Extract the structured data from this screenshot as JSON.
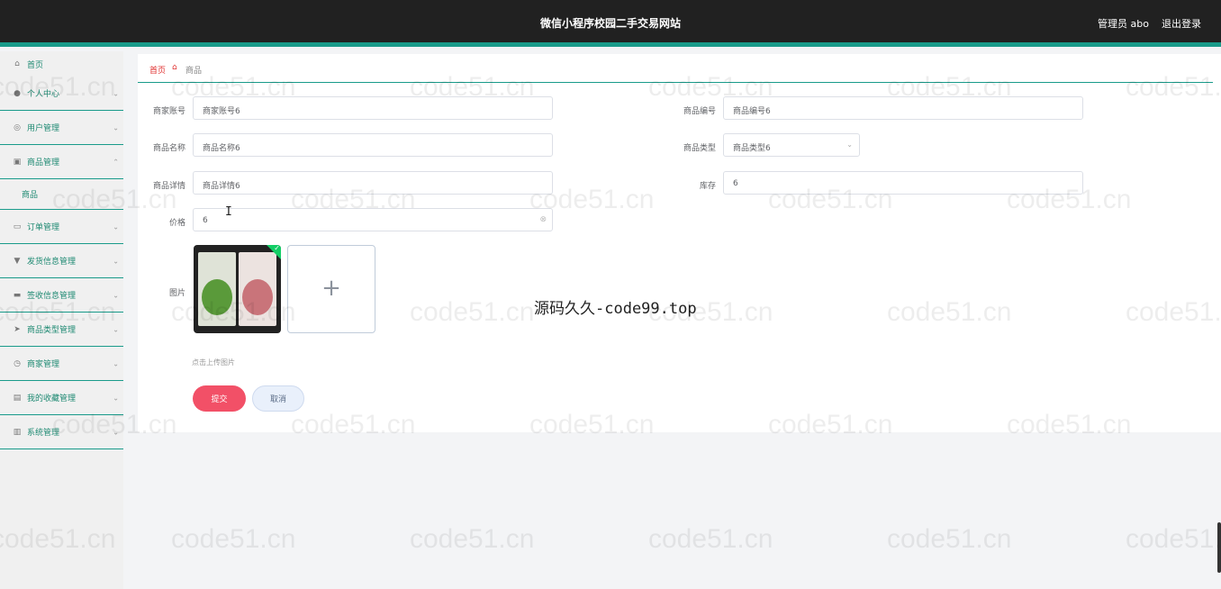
{
  "header": {
    "title": "微信小程序校园二手交易网站",
    "user_label": "管理员 abo",
    "logout_label": "退出登录"
  },
  "sidebar": {
    "items": [
      {
        "label": "首页",
        "icon": "home-icon",
        "glyph": "⌂"
      },
      {
        "label": "个人中心",
        "icon": "person-icon",
        "glyph": "●"
      },
      {
        "label": "用户管理",
        "icon": "users-icon",
        "glyph": "◎"
      },
      {
        "label": "商品管理",
        "icon": "goods-icon",
        "glyph": "▣"
      },
      {
        "label": "商品",
        "icon": "",
        "glyph": ""
      },
      {
        "label": "订单管理",
        "icon": "order-icon",
        "glyph": "▭"
      },
      {
        "label": "发货信息管理",
        "icon": "truck-icon",
        "glyph": "▼"
      },
      {
        "label": "签收信息管理",
        "icon": "sign-icon",
        "glyph": "▬"
      },
      {
        "label": "商品类型管理",
        "icon": "send-icon",
        "glyph": "➤"
      },
      {
        "label": "商家管理",
        "icon": "clock-icon",
        "glyph": "◷"
      },
      {
        "label": "我的收藏管理",
        "icon": "favorite-icon",
        "glyph": "▤"
      },
      {
        "label": "系统管理",
        "icon": "system-icon",
        "glyph": "▥"
      }
    ]
  },
  "breadcrumb": {
    "home": "首页",
    "current": "商品"
  },
  "form": {
    "merchant_account_label": "商家账号",
    "merchant_account_value": "商家账号6",
    "goods_no_label": "商品编号",
    "goods_no_value": "商品编号6",
    "goods_name_label": "商品名称",
    "goods_name_value": "商品名称6",
    "goods_type_label": "商品类型",
    "goods_type_value": "商品类型6",
    "goods_detail_label": "商品详情",
    "goods_detail_value": "商品详情6",
    "stock_label": "库存",
    "stock_value": "6",
    "price_label": "价格",
    "price_value": "6",
    "image_label": "图片",
    "upload_hint": "点击上传图片",
    "submit_label": "提交",
    "cancel_label": "取消"
  },
  "overlay_text": "源码久久-code99.top",
  "watermark": "code51.cn",
  "colors": {
    "topbar": "#212121",
    "accent": "#199b8a",
    "submit": "#f25067",
    "breadcrumb": "#e0302f"
  }
}
